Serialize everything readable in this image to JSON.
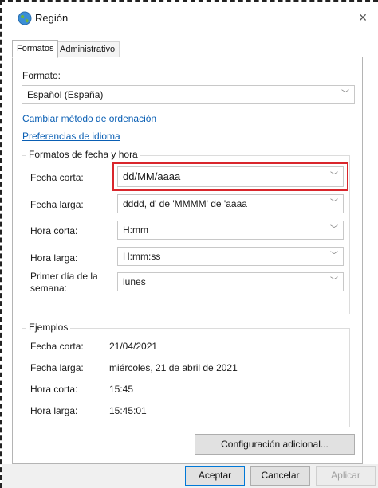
{
  "window": {
    "title": "Región",
    "close_symbol": "×"
  },
  "tabs": [
    {
      "label": "Formatos",
      "active": true
    },
    {
      "label": "Administrativo",
      "active": false
    }
  ],
  "format": {
    "label": "Formato:",
    "value": "Español (España)"
  },
  "links": {
    "sort_method": "Cambiar método de ordenación",
    "language_prefs": "Preferencias de idioma"
  },
  "date_time_formats": {
    "group_title": "Formatos de fecha y hora",
    "rows": [
      {
        "label": "Fecha corta:",
        "value": "dd/MM/aaaa"
      },
      {
        "label": "Fecha larga:",
        "value": "dddd, d' de 'MMMM' de 'aaaa"
      },
      {
        "label": "Hora corta:",
        "value": "H:mm"
      },
      {
        "label": "Hora larga:",
        "value": "H:mm:ss"
      },
      {
        "label": "Primer día de la semana:",
        "value": "lunes"
      }
    ]
  },
  "examples": {
    "group_title": "Ejemplos",
    "rows": [
      {
        "label": "Fecha corta:",
        "value": "21/04/2021"
      },
      {
        "label": "Fecha larga:",
        "value": "miércoles, 21 de abril de 2021"
      },
      {
        "label": "Hora corta:",
        "value": "15:45"
      },
      {
        "label": "Hora larga:",
        "value": "15:45:01"
      }
    ]
  },
  "buttons": {
    "additional": "Configuración adicional...",
    "ok": "Aceptar",
    "cancel": "Cancelar",
    "apply": "Aplicar"
  },
  "colors": {
    "link": "#0a5fb4",
    "highlight": "#d9262c",
    "primary_border": "#0078d7"
  },
  "icons": {
    "title": "globe-icon",
    "combo": "chevron-down-icon"
  }
}
